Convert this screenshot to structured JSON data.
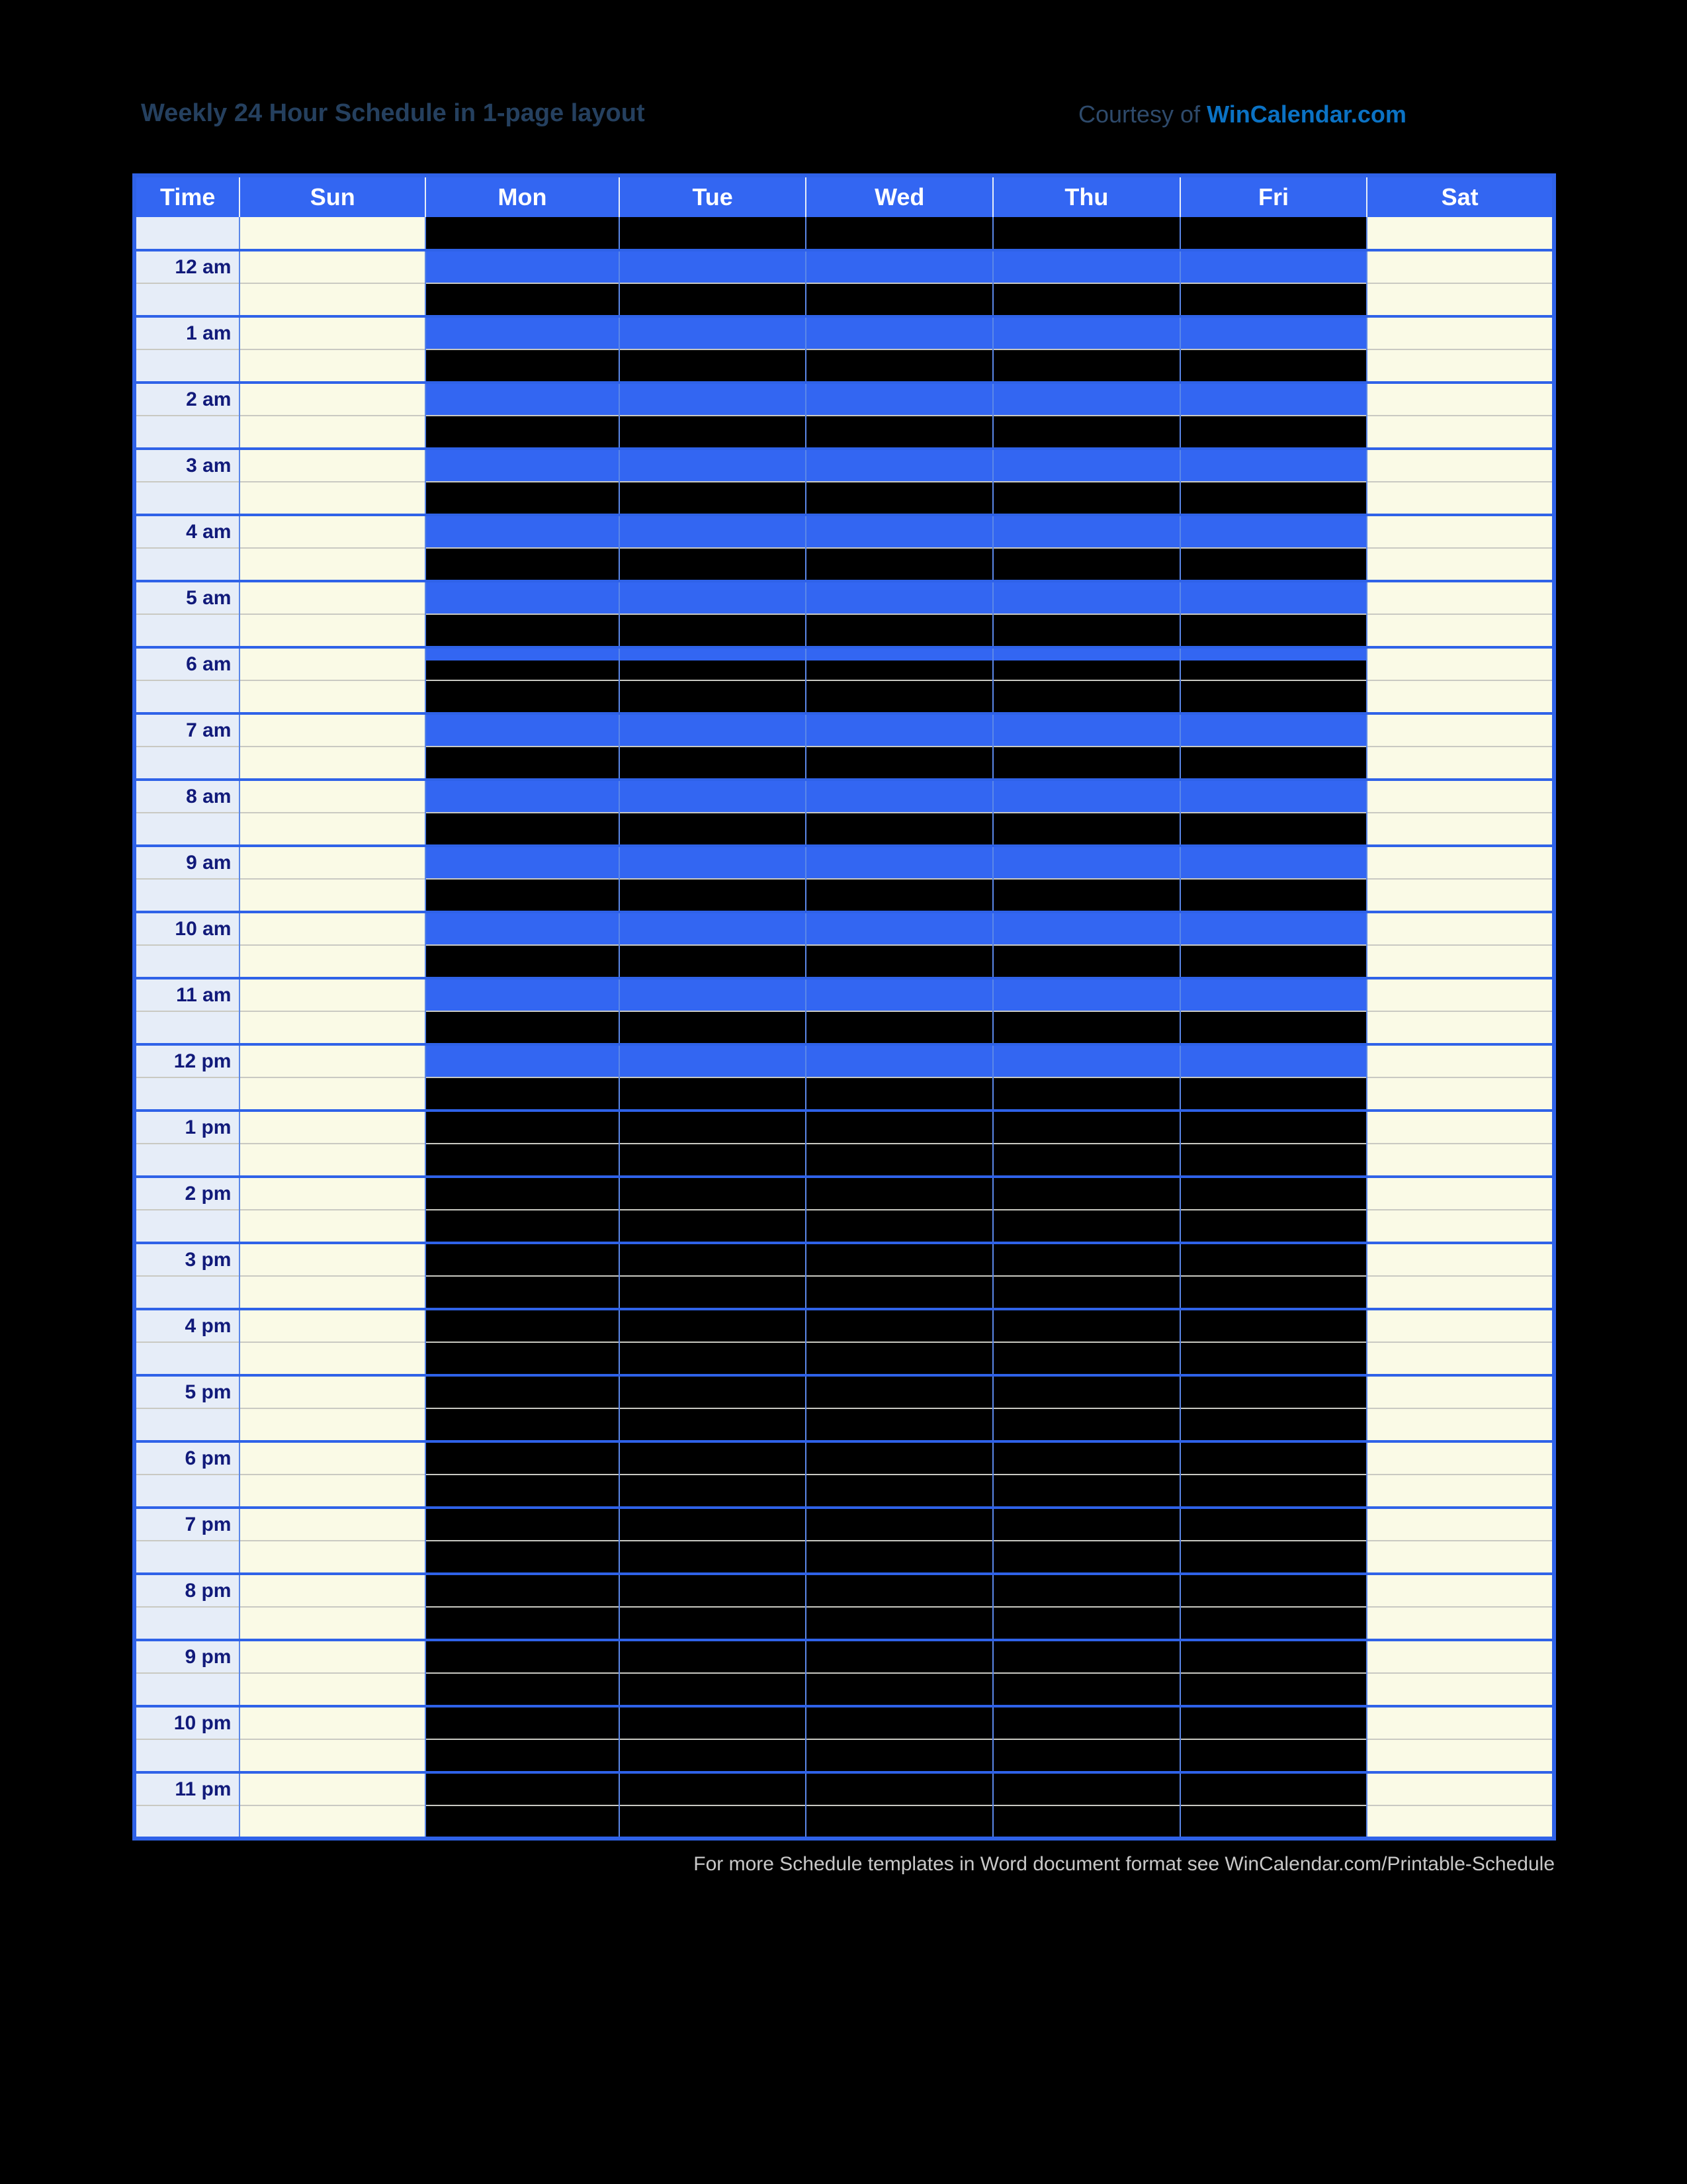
{
  "header": {
    "title": "Weekly 24 Hour Schedule in 1-page layout",
    "courtesy_prefix": "Courtesy of ",
    "courtesy_brand": "WinCalendar.com"
  },
  "footer": {
    "note": "For more Schedule templates in Word document format see WinCalendar.com/Printable-Schedule"
  },
  "colors": {
    "header_blue": "#3366f2",
    "grid_blue": "#2f62e8",
    "time_col_bg": "#e6edf8",
    "day_col_bg": "#fafae6",
    "time_text": "#111a7a",
    "title_text": "#25405f",
    "brand_text": "#0b72c4",
    "redacted_black": "#000000",
    "page_bg": "#000000"
  },
  "table": {
    "columns": [
      "Time",
      "Sun",
      "Mon",
      "Tue",
      "Wed",
      "Thu",
      "Fri",
      "Sat"
    ],
    "day_columns": [
      "Sun",
      "Mon",
      "Tue",
      "Wed",
      "Thu",
      "Fri",
      "Sat"
    ],
    "redacted_columns": [
      "Mon",
      "Tue",
      "Wed",
      "Thu",
      "Fri"
    ],
    "open_columns": [
      "Sun",
      "Sat"
    ],
    "time_labels": [
      "",
      "12 am",
      "1 am",
      "2 am",
      "3 am",
      "4 am",
      "5 am",
      "6 am",
      "7 am",
      "8 am",
      "9 am",
      "10 am",
      "11 am",
      "12 pm",
      "1 pm",
      "2 pm",
      "3 pm",
      "4 pm",
      "5 pm",
      "6 pm",
      "7 pm",
      "8 pm",
      "9 pm",
      "10 pm",
      "11 pm"
    ],
    "rows": [
      {
        "label": "",
        "type": "blank",
        "band": "blk",
        "half_band": null
      },
      {
        "label": "12 am",
        "type": "hour",
        "band": "blu",
        "half_band": "blk"
      },
      {
        "label": "1 am",
        "type": "hour",
        "band": "blu",
        "half_band": "blk"
      },
      {
        "label": "2 am",
        "type": "hour",
        "band": "blu",
        "half_band": "blk"
      },
      {
        "label": "3 am",
        "type": "hour",
        "band": "blu",
        "half_band": "blk"
      },
      {
        "label": "4 am",
        "type": "hour",
        "band": "blu",
        "half_band": "blk"
      },
      {
        "label": "5 am",
        "type": "hour",
        "band": "blu",
        "half_band": "blk"
      },
      {
        "label": "6 am",
        "type": "hour",
        "band": "blu-thin",
        "half_band": "blk"
      },
      {
        "label": "7 am",
        "type": "hour",
        "band": "blu",
        "half_band": "blk"
      },
      {
        "label": "8 am",
        "type": "hour",
        "band": "blu",
        "half_band": "blk"
      },
      {
        "label": "9 am",
        "type": "hour",
        "band": "blu",
        "half_band": "blk"
      },
      {
        "label": "10 am",
        "type": "hour",
        "band": "blu",
        "half_band": "blk"
      },
      {
        "label": "11 am",
        "type": "hour",
        "band": "blu",
        "half_band": "blk"
      },
      {
        "label": "12 pm",
        "type": "hour",
        "band": "blu",
        "half_band": "blk"
      },
      {
        "label": "1 pm",
        "type": "hour",
        "band": "blk",
        "half_band": "blk"
      },
      {
        "label": "2 pm",
        "type": "hour",
        "band": "blk",
        "half_band": "blk"
      },
      {
        "label": "3 pm",
        "type": "hour",
        "band": "blk",
        "half_band": "blk"
      },
      {
        "label": "4 pm",
        "type": "hour",
        "band": "blk",
        "half_band": "blk"
      },
      {
        "label": "5 pm",
        "type": "hour",
        "band": "blk",
        "half_band": "blk"
      },
      {
        "label": "6 pm",
        "type": "hour",
        "band": "blk",
        "half_band": "blk"
      },
      {
        "label": "7 pm",
        "type": "hour",
        "band": "blk",
        "half_band": "blk"
      },
      {
        "label": "8 pm",
        "type": "hour",
        "band": "blk",
        "half_band": "blk"
      },
      {
        "label": "9 pm",
        "type": "hour",
        "band": "blk",
        "half_band": "blk"
      },
      {
        "label": "10 pm",
        "type": "hour",
        "band": "blk",
        "half_band": "blk"
      },
      {
        "label": "11 pm",
        "type": "hour",
        "band": "blk",
        "half_band": "blk"
      }
    ]
  }
}
